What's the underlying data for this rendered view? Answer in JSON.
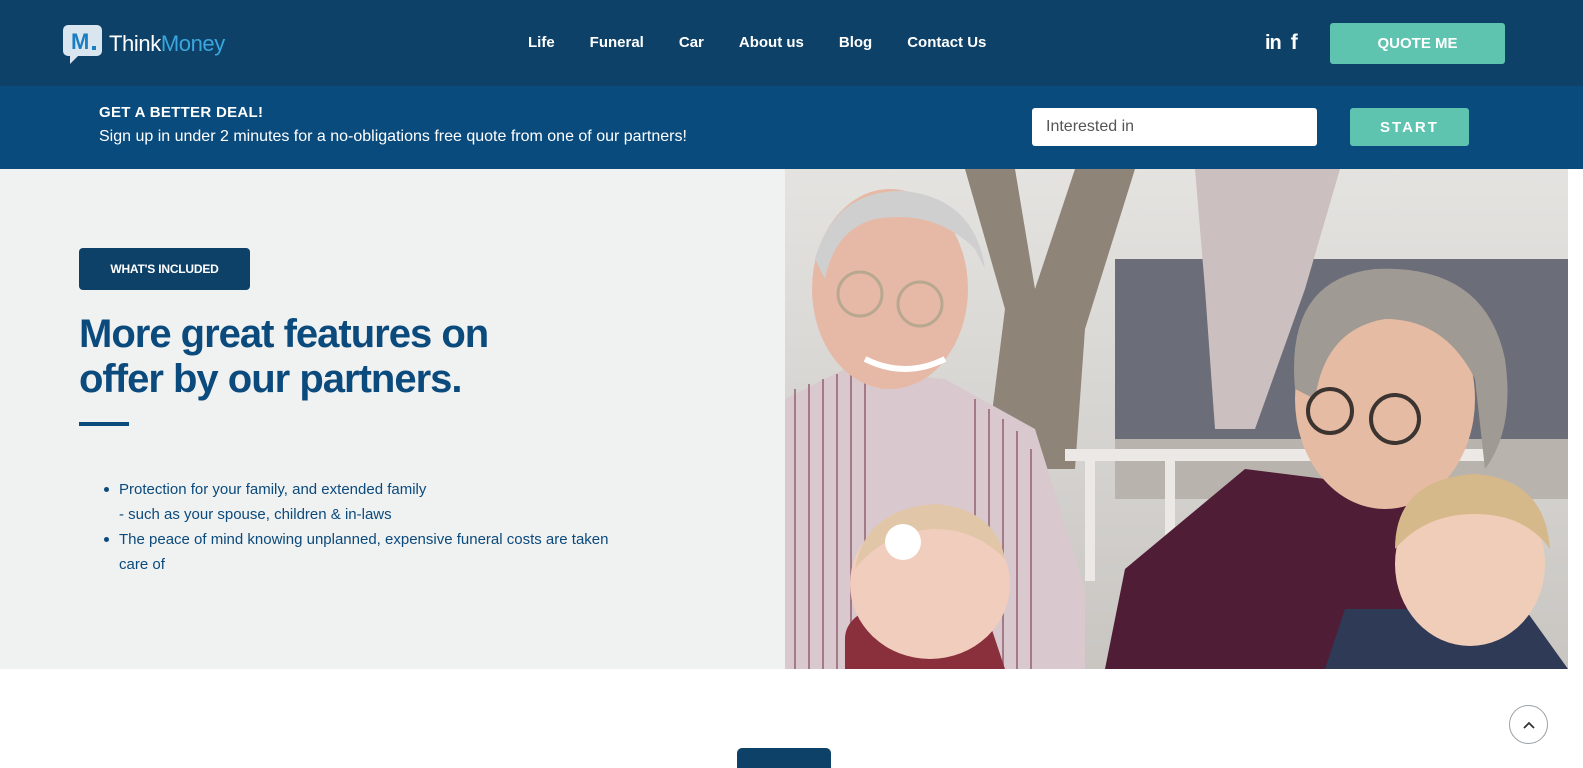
{
  "brand": {
    "name_part1": "Think",
    "name_part2": "Money",
    "accent": "#3aa6dd",
    "primary": "#0d4168",
    "teal": "#5ec4b0"
  },
  "nav": {
    "items": [
      "Life",
      "Funeral",
      "Car",
      "About us",
      "Blog",
      "Contact Us"
    ]
  },
  "social": {
    "linkedin": "in",
    "facebook": "f"
  },
  "header": {
    "quote_label": "QUOTE ME"
  },
  "deal": {
    "title": "GET A BETTER DEAL!",
    "subtitle": "Sign up in under 2 minutes for a no-obligations free quote from one of our partners!",
    "input_placeholder": "Interested in",
    "start_label": "START"
  },
  "features": {
    "badge": "WHAT'S INCLUDED",
    "headline_line1": "More great features on",
    "headline_line2": "offer by our partners.",
    "bullets": [
      {
        "line1": "Protection for your family, and extended family",
        "line2": "- such as your spouse, children & in-laws"
      },
      {
        "line1": "The peace of mind knowing unplanned, expensive funeral costs are taken",
        "line2": "care of"
      }
    ]
  },
  "icons": {
    "scroll_top": "chevron-up-icon"
  }
}
